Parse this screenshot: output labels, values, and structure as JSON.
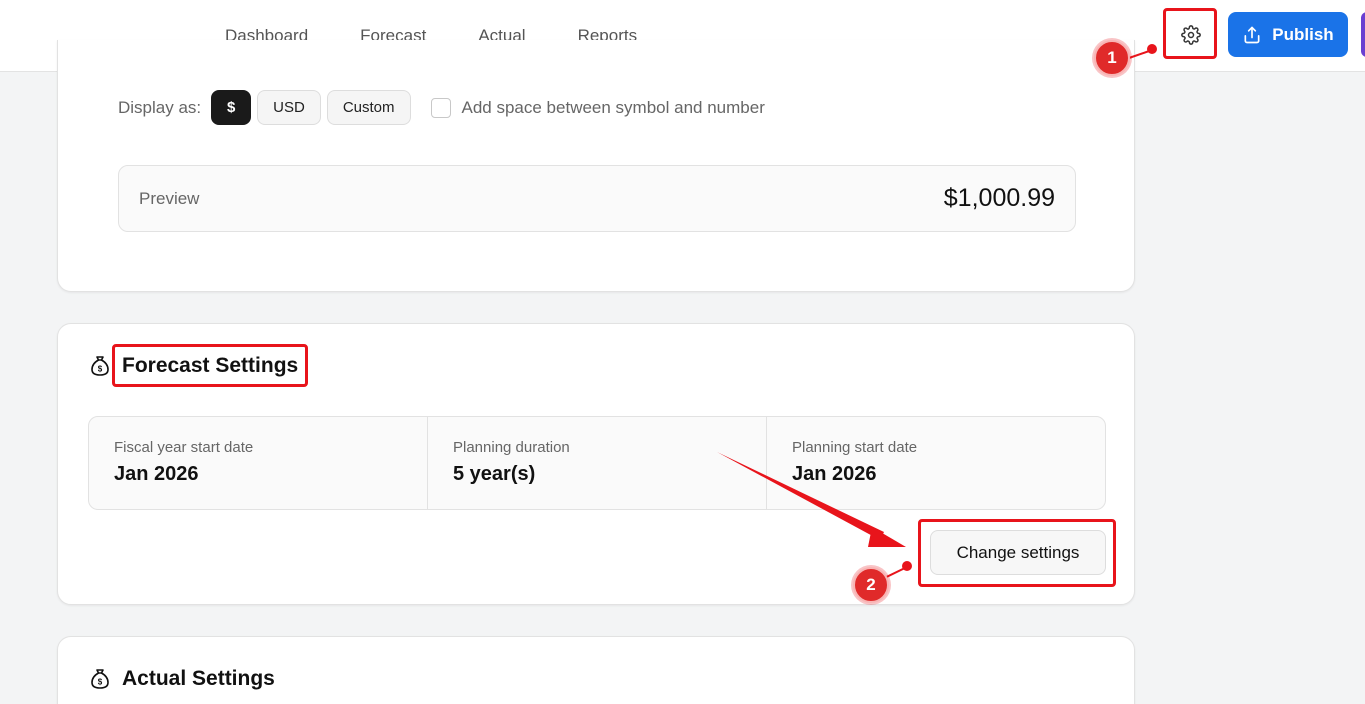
{
  "nav": {
    "items": [
      "Dashboard",
      "Forecast",
      "Actual",
      "Reports"
    ]
  },
  "toolbar": {
    "settings_icon": "gear-icon",
    "publish_label": "Publish",
    "publish_icon": "upload-icon"
  },
  "currency": {
    "display_label": "Display as:",
    "options": [
      "$",
      "USD",
      "Custom"
    ],
    "selected": "$",
    "space_checkbox_label": "Add space between symbol and number",
    "space_checked": false,
    "preview_label": "Preview",
    "preview_value": "$1,000.99"
  },
  "forecast_settings": {
    "title": "Forecast Settings",
    "fields": [
      {
        "label": "Fiscal year start date",
        "value": "Jan 2026"
      },
      {
        "label": "Planning duration",
        "value": "5 year(s)"
      },
      {
        "label": "Planning start date",
        "value": "Jan 2026"
      }
    ],
    "change_button": "Change settings"
  },
  "actual_settings": {
    "title": "Actual Settings"
  },
  "annotations": {
    "step1": "1",
    "step2": "2",
    "highlight_color": "#e8141b"
  },
  "colors": {
    "primary": "#1a73e8",
    "accent": "#6a3fd1",
    "annotation": "#e8141b"
  }
}
